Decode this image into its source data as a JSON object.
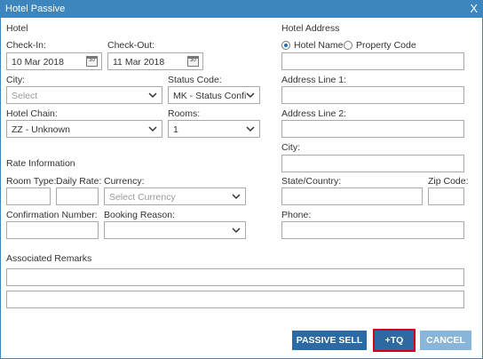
{
  "window": {
    "title": "Hotel Passive",
    "close_glyph": "X"
  },
  "hotel": {
    "section_label": "Hotel",
    "check_in": {
      "label": "Check-In:",
      "value": "10 Mar 2018",
      "icon": "calendar-icon",
      "icon_text": "30"
    },
    "check_out": {
      "label": "Check-Out:",
      "value": "11 Mar 2018",
      "icon": "calendar-icon",
      "icon_text": "30"
    },
    "city": {
      "label": "City:",
      "placeholder": "Select"
    },
    "status_code": {
      "label": "Status Code:",
      "value": "MK - Status Confirr"
    },
    "hotel_chain": {
      "label": "Hotel Chain:",
      "value": "ZZ - Unknown"
    },
    "rooms": {
      "label": "Rooms:",
      "value": "1"
    }
  },
  "rate": {
    "section_label": "Rate Information",
    "room_type": {
      "label": "Room Type:",
      "value": ""
    },
    "daily_rate": {
      "label": "Daily Rate:",
      "value": ""
    },
    "currency": {
      "label": "Currency:",
      "placeholder": "Select Currency"
    },
    "confirmation_number": {
      "label": "Confirmation Number:",
      "value": ""
    },
    "booking_reason": {
      "label": "Booking Reason:",
      "value": ""
    }
  },
  "address": {
    "section_label": "Hotel Address",
    "radio_hotel_name": {
      "label": "Hotel Name",
      "selected": true
    },
    "radio_property_code": {
      "label": "Property Code",
      "selected": false
    },
    "line1": {
      "label": "Address Line 1:",
      "value": ""
    },
    "line2": {
      "label": "Address Line 2:",
      "value": ""
    },
    "city": {
      "label": "City:",
      "value": ""
    },
    "state_country": {
      "label": "State/Country:",
      "value": ""
    },
    "zip": {
      "label": "Zip Code:",
      "value": ""
    },
    "phone": {
      "label": "Phone:",
      "value": ""
    }
  },
  "remarks": {
    "section_label": "Associated Remarks",
    "line1": "",
    "line2": ""
  },
  "buttons": {
    "passive_sell": "PASSIVE SELL",
    "tq": "+TQ",
    "cancel": "CANCEL"
  },
  "colors": {
    "titlebar": "#3d86bd",
    "button_dark": "#2d6aa3",
    "button_light": "#89b6d8",
    "highlight": "#d0021b"
  }
}
